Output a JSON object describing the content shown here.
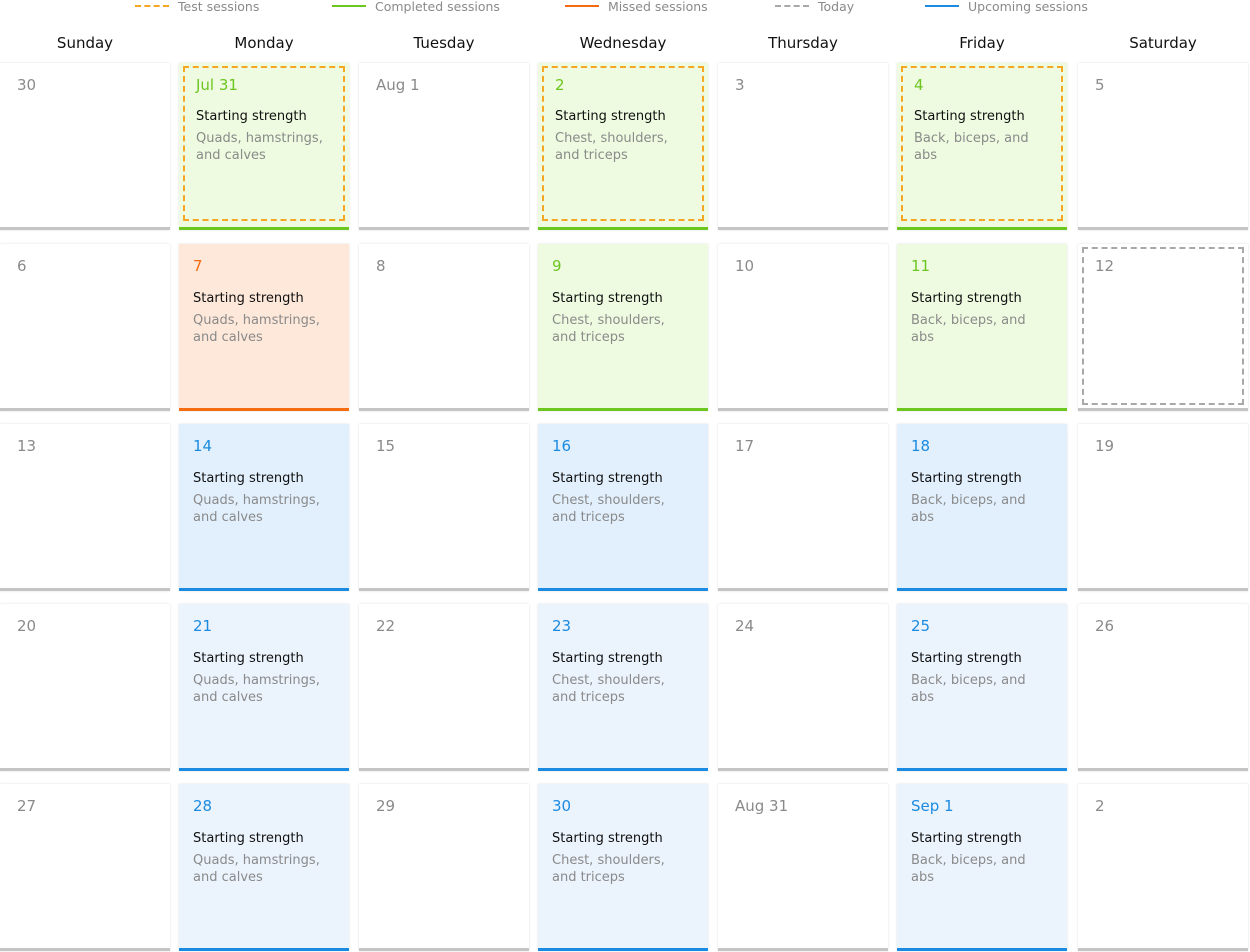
{
  "legend": [
    {
      "label": "Test sessions",
      "color": "#f5a623",
      "style": "dashed",
      "icon": "dashed-line-icon"
    },
    {
      "label": "Completed sessions",
      "color": "#6cc620",
      "style": "solid",
      "icon": "solid-line-icon"
    },
    {
      "label": "Missed sessions",
      "color": "#f56c10",
      "style": "solid",
      "icon": "solid-line-icon"
    },
    {
      "label": "Today",
      "color": "#a8a8a8",
      "style": "dashed",
      "icon": "dashed-line-icon"
    },
    {
      "label": "Upcoming sessions",
      "color": "#1a8be0",
      "style": "solid",
      "icon": "solid-line-icon"
    }
  ],
  "days": [
    "Sunday",
    "Monday",
    "Tuesday",
    "Wednesday",
    "Thursday",
    "Friday",
    "Saturday"
  ],
  "colors": {
    "completed_bg": "#eefbe0",
    "completed_accent": "#6cc620",
    "missed_bg": "#fde8da",
    "missed_accent": "#f56c10",
    "upcoming_bg": "#e2f0fd",
    "upcoming_bg_light": "#ebf3fd",
    "upcoming_accent": "#1a8be0",
    "empty_bg": "#ffffff",
    "empty_accent": "#c4c4c4",
    "date_default": "#8a8a8a",
    "test_outline": "#f5a623",
    "today_outline": "#a8a8a8"
  },
  "weeks": [
    [
      {
        "date": "30",
        "status": "empty"
      },
      {
        "date": "Jul 31",
        "status": "completed",
        "test": true,
        "title": "Starting strength",
        "desc": "Quads, hamstrings, and calves"
      },
      {
        "date": "Aug 1",
        "status": "empty"
      },
      {
        "date": "2",
        "status": "completed",
        "test": true,
        "title": "Starting strength",
        "desc": "Chest, shoulders, and triceps"
      },
      {
        "date": "3",
        "status": "empty"
      },
      {
        "date": "4",
        "status": "completed",
        "test": true,
        "title": "Starting strength",
        "desc": "Back, biceps, and abs"
      },
      {
        "date": "5",
        "status": "empty"
      }
    ],
    [
      {
        "date": "6",
        "status": "empty"
      },
      {
        "date": "7",
        "status": "missed",
        "title": "Starting strength",
        "desc": "Quads, hamstrings, and calves"
      },
      {
        "date": "8",
        "status": "empty"
      },
      {
        "date": "9",
        "status": "completed",
        "title": "Starting strength",
        "desc": "Chest, shoulders, and triceps"
      },
      {
        "date": "10",
        "status": "empty"
      },
      {
        "date": "11",
        "status": "completed",
        "title": "Starting strength",
        "desc": "Back, biceps, and abs"
      },
      {
        "date": "12",
        "status": "empty",
        "today": true
      }
    ],
    [
      {
        "date": "13",
        "status": "empty"
      },
      {
        "date": "14",
        "status": "upcoming",
        "title": "Starting strength",
        "desc": "Quads, hamstrings, and calves"
      },
      {
        "date": "15",
        "status": "empty"
      },
      {
        "date": "16",
        "status": "upcoming",
        "title": "Starting strength",
        "desc": "Chest, shoulders, and triceps"
      },
      {
        "date": "17",
        "status": "empty"
      },
      {
        "date": "18",
        "status": "upcoming",
        "title": "Starting strength",
        "desc": "Back, biceps, and abs"
      },
      {
        "date": "19",
        "status": "empty"
      }
    ],
    [
      {
        "date": "20",
        "status": "empty"
      },
      {
        "date": "21",
        "status": "upcoming",
        "light": true,
        "title": "Starting strength",
        "desc": "Quads, hamstrings, and calves"
      },
      {
        "date": "22",
        "status": "empty"
      },
      {
        "date": "23",
        "status": "upcoming",
        "light": true,
        "title": "Starting strength",
        "desc": "Chest, shoulders, and triceps"
      },
      {
        "date": "24",
        "status": "empty"
      },
      {
        "date": "25",
        "status": "upcoming",
        "light": true,
        "title": "Starting strength",
        "desc": "Back, biceps, and abs"
      },
      {
        "date": "26",
        "status": "empty"
      }
    ],
    [
      {
        "date": "27",
        "status": "empty"
      },
      {
        "date": "28",
        "status": "upcoming",
        "light": true,
        "title": "Starting strength",
        "desc": "Quads, hamstrings, and calves"
      },
      {
        "date": "29",
        "status": "empty"
      },
      {
        "date": "30",
        "status": "upcoming",
        "light": true,
        "title": "Starting strength",
        "desc": "Chest, shoulders, and triceps"
      },
      {
        "date": "Aug 31",
        "status": "empty"
      },
      {
        "date": "Sep 1",
        "status": "upcoming",
        "light": true,
        "title": "Starting strength",
        "desc": "Back, biceps, and abs"
      },
      {
        "date": "2",
        "status": "empty"
      }
    ]
  ]
}
